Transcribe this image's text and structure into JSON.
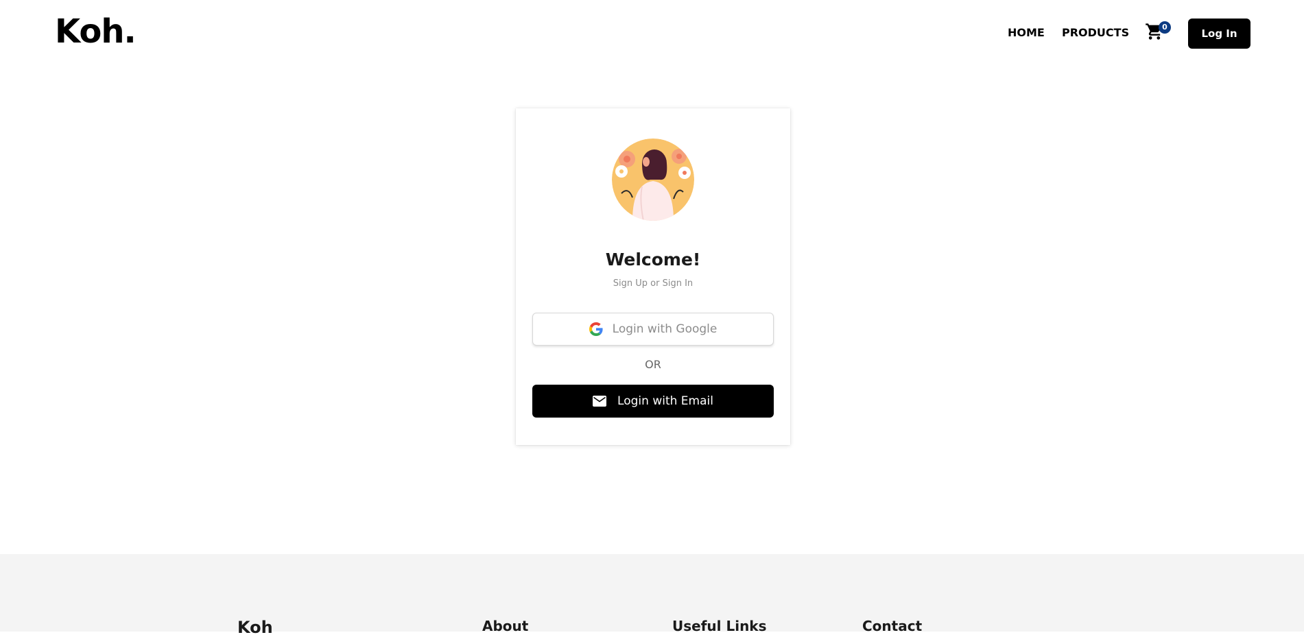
{
  "header": {
    "logo": "Koh.",
    "nav": {
      "home": "HOME",
      "products": "PRODUCTS"
    },
    "cart": {
      "icon": "cart-icon",
      "count": "0",
      "badge_color": "#0d3b82"
    },
    "login_label": "Log In"
  },
  "card": {
    "avatar_icon": "woman-illustration",
    "title": "Welcome!",
    "subtitle": "Sign Up or Sign In",
    "google_button": {
      "icon": "google-icon",
      "label": "Login with Google"
    },
    "divider": "OR",
    "email_button": {
      "icon": "mail-icon",
      "label": "Login with Email"
    }
  },
  "footer": {
    "brand": "Koh",
    "columns": [
      "About",
      "Useful Links",
      "Contact"
    ]
  },
  "colors": {
    "primary": "#000000",
    "background": "#ffffff",
    "footer_bg": "#f4f4f4",
    "avatar_bg": "#f9c36b"
  }
}
